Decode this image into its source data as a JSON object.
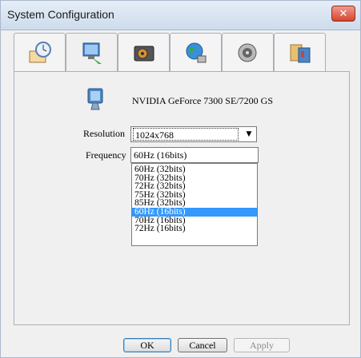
{
  "window": {
    "title": "System Configuration"
  },
  "tabs": [
    {
      "icon": "clock-settings-icon"
    },
    {
      "icon": "monitor-display-icon"
    },
    {
      "icon": "hard-disk-icon"
    },
    {
      "icon": "network-globe-icon"
    },
    {
      "icon": "speaker-audio-icon"
    },
    {
      "icon": "system-tools-icon"
    }
  ],
  "display": {
    "adapter_name": "NVIDIA GeForce 7300 SE/7200 GS",
    "resolution_label": "Resolution",
    "resolution_value": "1024x768",
    "frequency_label": "Frequency",
    "frequency_value": "60Hz (16bits)",
    "frequency_options": [
      "60Hz (32bits)",
      "70Hz (32bits)",
      "72Hz (32bits)",
      "75Hz (32bits)",
      "85Hz (32bits)",
      "60Hz (16bits)",
      "70Hz (16bits)",
      "72Hz (16bits)"
    ],
    "selected_index": 5
  },
  "buttons": {
    "ok": "OK",
    "cancel": "Cancel",
    "apply": "Apply"
  },
  "colors": {
    "selection": "#3399ff",
    "close": "#d4452f"
  }
}
